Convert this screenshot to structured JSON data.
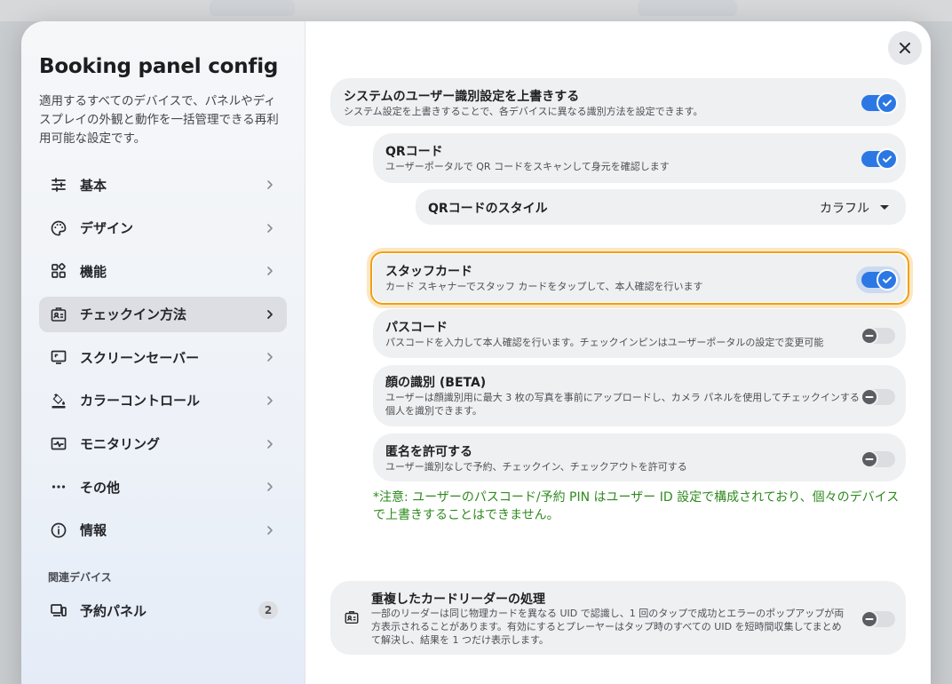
{
  "sidebar": {
    "title": "Booking panel config",
    "description": "適用するすべてのデバイスで、パネルやディスプレイの外観と動作を一括管理できる再利用可能な設定です。",
    "items": [
      {
        "label": "基本",
        "icon": "sliders-icon"
      },
      {
        "label": "デザイン",
        "icon": "palette-icon"
      },
      {
        "label": "機能",
        "icon": "apps-icon"
      },
      {
        "label": "チェックイン方法",
        "icon": "id-badge-icon"
      },
      {
        "label": "スクリーンセーバー",
        "icon": "monitor-icon"
      },
      {
        "label": "カラーコントロール",
        "icon": "paint-bucket-icon"
      },
      {
        "label": "モニタリング",
        "icon": "monitoring-icon"
      },
      {
        "label": "その他",
        "icon": "more-icon"
      },
      {
        "label": "情報",
        "icon": "info-icon"
      }
    ],
    "active_index": 3,
    "section_label": "関連デバイス",
    "device": {
      "label": "予約パネル",
      "count": "2",
      "icon": "devices-icon"
    }
  },
  "main": {
    "override": {
      "title": "システムのユーザー識別設定を上書きする",
      "subtitle": "システム設定を上書きすることで、各デバイスに異なる識別方法を設定できます。",
      "enabled": true
    },
    "qr": {
      "title": "QRコード",
      "subtitle": "ユーザーポータルで QR コードをスキャンして身元を確認します",
      "enabled": true
    },
    "qr_style": {
      "label": "QRコードのスタイル",
      "value": "カラフル"
    },
    "staff_card": {
      "title": "スタッフカード",
      "subtitle": "カード スキャナーでスタッフ カードをタップして、本人確認を行います",
      "enabled": true
    },
    "passcode": {
      "title": "パスコード",
      "subtitle": "パスコードを入力して本人確認を行います。チェックインピンはユーザーポータルの設定で変更可能",
      "enabled": false
    },
    "face": {
      "title": "顔の識別 (BETA)",
      "subtitle_line1": "ユーザーは顔識別用に最大 3 枚の写真を事前にアップロードし、カメラ パネルを使用してチェックインする",
      "subtitle_line2": "個人を識別できます。",
      "enabled": false
    },
    "anonymous": {
      "title": "匿名を許可する",
      "subtitle": "ユーザー識別なしで予約、チェックイン、チェックアウトを許可する",
      "enabled": false
    },
    "note_line1": "*注意: ユーザーのパスコード/予約 PIN はユーザー ID 設定で構成されており、個々のデバイス",
    "note_line2": "で上書きすることはできません。",
    "duplicate": {
      "title": "重複したカードリーダーの処理",
      "line1": "一部のリーダーは同じ物理カードを異なる UID で認識し、1 回のタップで成功とエラーのポップアップが両",
      "line2": "方表示されることがあります。有効にするとプレーヤーはタップ時のすべての UID を短時間収集してまとめ",
      "line3": "て解決し、結果を 1 つだけ表示します。",
      "enabled": false
    }
  },
  "colors": {
    "accent": "#2b78e4",
    "focus": "#f1a014",
    "note": "#2e8a1e"
  }
}
